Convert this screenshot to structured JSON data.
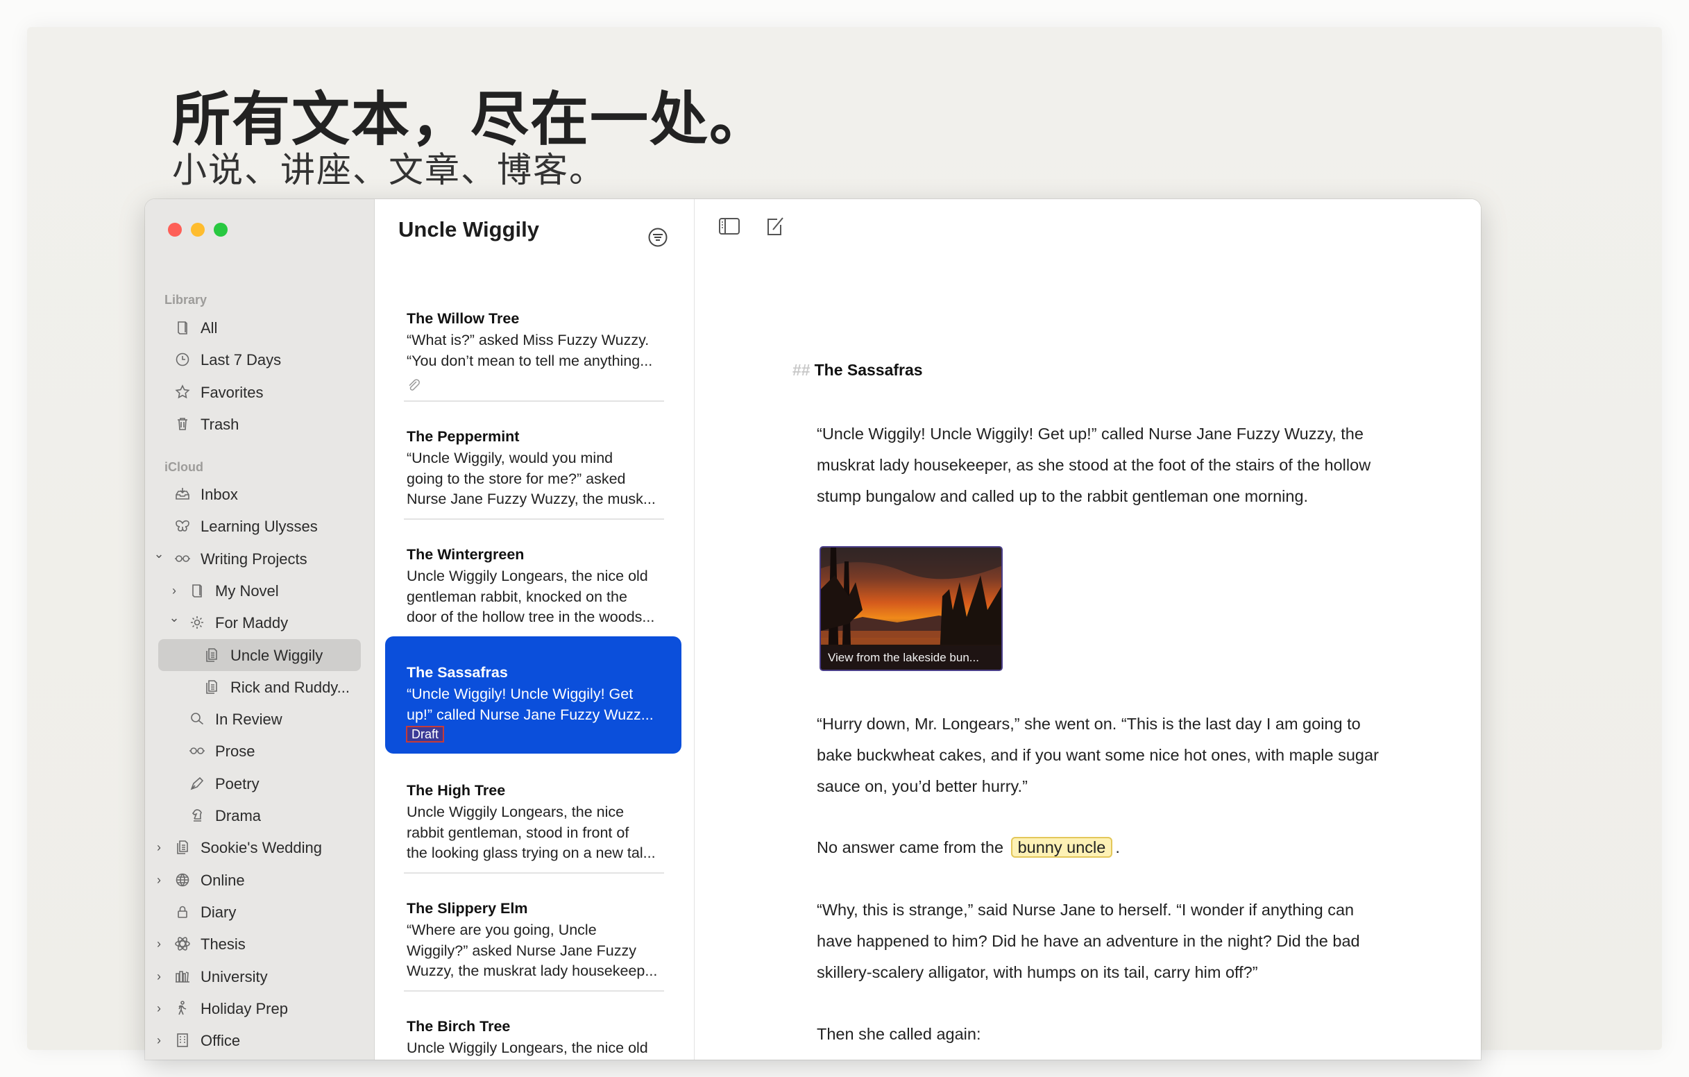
{
  "hero": {
    "title": "所有文本，尽在一处。",
    "subtitle": "小说、讲座、文章、博客。"
  },
  "sidebar": {
    "sections": [
      {
        "label": "Library"
      },
      {
        "label": "iCloud"
      }
    ],
    "items": [
      {
        "label": "All",
        "icon": "book-icon",
        "level": 0,
        "chevron": "",
        "section": 0
      },
      {
        "label": "Last 7 Days",
        "icon": "clock-icon",
        "level": 0,
        "chevron": "",
        "section": 0
      },
      {
        "label": "Favorites",
        "icon": "star-icon",
        "level": 0,
        "chevron": "",
        "section": 0
      },
      {
        "label": "Trash",
        "icon": "trash-icon",
        "level": 0,
        "chevron": "",
        "section": 0
      },
      {
        "label": "Inbox",
        "icon": "inbox-icon",
        "level": 0,
        "chevron": "",
        "section": 1
      },
      {
        "label": "Learning Ulysses",
        "icon": "butterfly-icon",
        "level": 0,
        "chevron": "",
        "section": 1
      },
      {
        "label": "Writing Projects",
        "icon": "glasses-icon",
        "level": 0,
        "chevron": "down",
        "section": 1
      },
      {
        "label": "My Novel",
        "icon": "book-icon",
        "level": 1,
        "chevron": "right",
        "section": 1
      },
      {
        "label": "For Maddy",
        "icon": "sun-icon",
        "level": 1,
        "chevron": "down",
        "section": 1
      },
      {
        "label": "Uncle Wiggily",
        "icon": "sheets-icon",
        "level": 2,
        "chevron": "",
        "section": 1,
        "selected": true
      },
      {
        "label": "Rick and Ruddy...",
        "icon": "sheets-icon",
        "level": 2,
        "chevron": "",
        "section": 1
      },
      {
        "label": "In Review",
        "icon": "search-icon",
        "level": 1,
        "chevron": "",
        "section": 1
      },
      {
        "label": "Prose",
        "icon": "glasses-icon",
        "level": 1,
        "chevron": "",
        "section": 1
      },
      {
        "label": "Poetry",
        "icon": "pen-icon",
        "level": 1,
        "chevron": "",
        "section": 1
      },
      {
        "label": "Drama",
        "icon": "chess-knight-icon",
        "level": 1,
        "chevron": "",
        "section": 1
      },
      {
        "label": "Sookie's Wedding",
        "icon": "sheets-icon",
        "level": 0,
        "chevron": "right",
        "section": 1
      },
      {
        "label": "Online",
        "icon": "globe-icon",
        "level": 0,
        "chevron": "right",
        "section": 1
      },
      {
        "label": "Diary",
        "icon": "lock-icon",
        "level": 0,
        "chevron": "",
        "section": 1
      },
      {
        "label": "Thesis",
        "icon": "atom-icon",
        "level": 0,
        "chevron": "right",
        "section": 1
      },
      {
        "label": "University",
        "icon": "books-icon",
        "level": 0,
        "chevron": "right",
        "section": 1
      },
      {
        "label": "Holiday Prep",
        "icon": "hiker-icon",
        "level": 0,
        "chevron": "right",
        "section": 1
      },
      {
        "label": "Office",
        "icon": "building-icon",
        "level": 0,
        "chevron": "right",
        "section": 1
      }
    ]
  },
  "sheet_list": {
    "title": "Uncle Wiggily",
    "items": [
      {
        "title": "The Willow Tree",
        "lines": [
          "“What is?” asked Miss Fuzzy Wuzzy.",
          "“You don’t mean to tell me anything..."
        ],
        "attachment": true
      },
      {
        "title": "The Peppermint",
        "lines": [
          "“Uncle Wiggily, would you mind",
          "going to the store for me?” asked",
          "Nurse Jane Fuzzy Wuzzy, the musk..."
        ]
      },
      {
        "title": "The Wintergreen",
        "lines": [
          "Uncle Wiggily Longears, the nice old",
          "gentleman rabbit, knocked on the",
          "door of the hollow tree in the woods..."
        ]
      },
      {
        "title": "The Sassafras",
        "lines": [
          "“Uncle Wiggily! Uncle Wiggily! Get",
          "up!” called Nurse Jane Fuzzy Wuzz..."
        ],
        "selected": true,
        "badge": "Draft"
      },
      {
        "title": "The High Tree",
        "lines": [
          "Uncle Wiggily Longears, the nice",
          "rabbit gentleman, stood in front of",
          "the looking glass trying on a new tal..."
        ]
      },
      {
        "title": "The Slippery Elm",
        "lines": [
          "“Where are you going, Uncle",
          "Wiggily?” asked Nurse Jane Fuzzy",
          "Wuzzy, the muskrat lady housekeep..."
        ]
      },
      {
        "title": "The Birch Tree",
        "lines": [
          "Uncle Wiggily Longears, the nice old"
        ]
      }
    ]
  },
  "editor": {
    "heading_marker": "##",
    "heading": "The Sassafras",
    "para1": [
      "“Uncle Wiggily! Uncle Wiggily! Get up!” called Nurse Jane Fuzzy Wuzzy, the",
      "muskrat lady housekeeper, as she stood at the foot of the stairs of the hollow",
      "stump bungalow and called up to the rabbit gentleman one morning."
    ],
    "image_caption": "View from the lakeside bun...",
    "para2": [
      "“Hurry down, Mr. Longears,” she went on. “This is the last day I am going to",
      "bake buckwheat cakes, and if you want some nice hot ones, with maple sugar",
      "sauce on, you’d better hurry.”"
    ],
    "para3_before": "No answer came from the",
    "para3_highlight": "bunny uncle",
    "para3_after": ".",
    "para4": [
      "“Why, this is strange,” said Nurse Jane to herself. “I wonder if anything can",
      "have happened to him? Did he have an adventure in the night? Did the bad",
      "skillery-scalery alligator, with humps on its tail, carry him off?”"
    ],
    "para5": [
      "Then she called again:"
    ]
  },
  "colors": {
    "selection": "#0b4fdb",
    "highlight": "#fdf1b5",
    "sidebar_bg": "#e8e7e5"
  }
}
